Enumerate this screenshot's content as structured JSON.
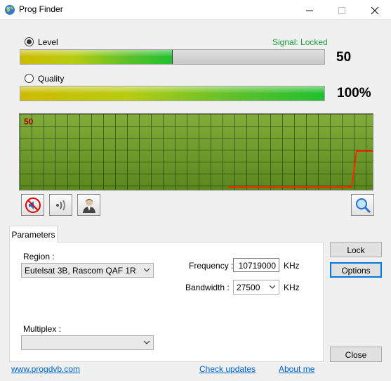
{
  "window": {
    "title": "Prog Finder",
    "icon": "globe-icon",
    "controls": [
      "minimize-icon",
      "maximize-icon",
      "close-icon"
    ]
  },
  "signal": {
    "level_label": "Level",
    "level_selected": true,
    "status_text": "Signal: Locked",
    "status_color": "#16a23a",
    "level_value": "50",
    "level_fraction": 0.5,
    "quality_label": "Quality",
    "quality_selected": false,
    "quality_value": "100%",
    "quality_fraction": 1.0
  },
  "graph": {
    "value_label": "50",
    "value_color": "#a00000",
    "line_color": "#ff2a00",
    "grid_color": "#3e6412",
    "background_color": "#6f9a2a"
  },
  "tool_buttons": [
    {
      "name": "mute-button",
      "icon": "speaker-muted-icon"
    },
    {
      "name": "sound-button",
      "icon": "speaker-waves-icon"
    },
    {
      "name": "user-button",
      "icon": "user-icon"
    },
    {
      "name": "search-button",
      "icon": "magnifier-icon"
    }
  ],
  "tabs": {
    "parameters": "Parameters"
  },
  "params": {
    "region_label": "Region :",
    "region_value": "Eutelsat 3B, Rascom QAF 1R",
    "frequency_label": "Frequency :",
    "frequency_value": "10719000",
    "frequency_unit": "KHz",
    "bandwidth_label": "Bandwidth :",
    "bandwidth_value": "27500",
    "bandwidth_unit": "KHz",
    "multiplex_label": "Multiplex :",
    "multiplex_value": ""
  },
  "buttons": {
    "lock": "Lock",
    "options": "Options",
    "close": "Close"
  },
  "links": {
    "website": "www.progdvb.com",
    "check_updates": "Check updates",
    "about": "About me"
  }
}
